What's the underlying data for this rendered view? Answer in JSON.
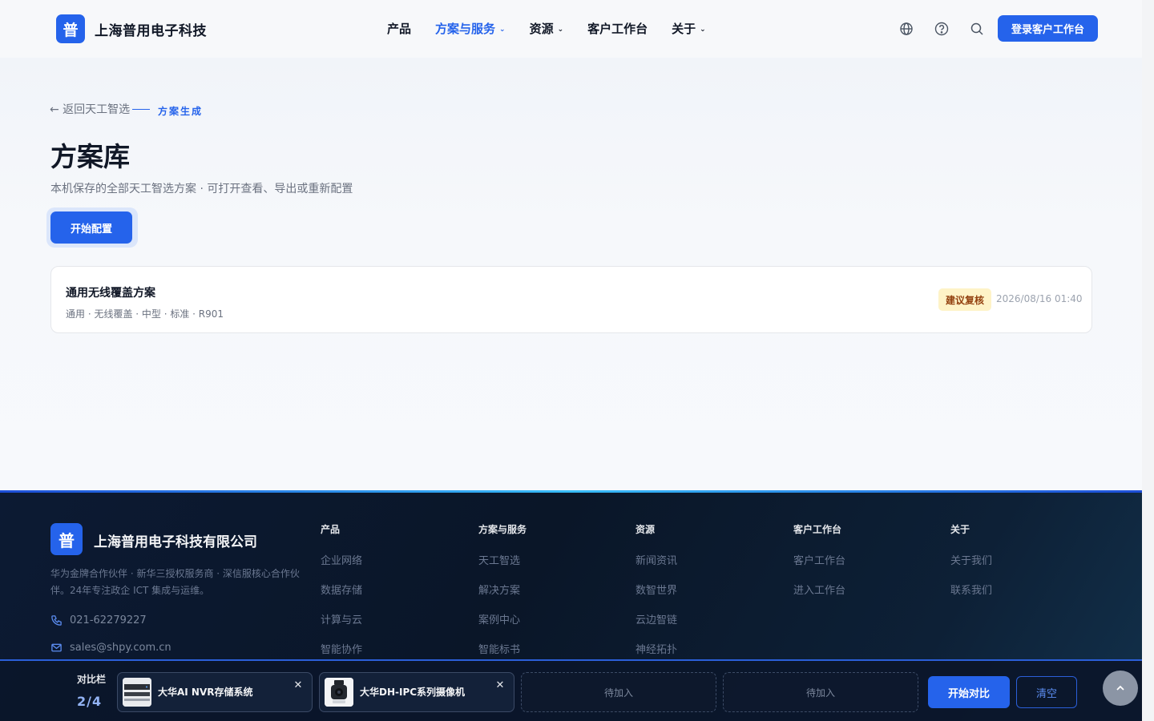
{
  "header": {
    "logo_char": "普",
    "brand": "上海普用电子科技",
    "nav": [
      {
        "label": "产品",
        "has_menu": false,
        "active": false
      },
      {
        "label": "方案与服务",
        "has_menu": true,
        "active": true
      },
      {
        "label": "资源",
        "has_menu": true,
        "active": false
      },
      {
        "label": "客户工作台",
        "has_menu": false,
        "active": false
      },
      {
        "label": "关于",
        "has_menu": true,
        "active": false
      }
    ],
    "icons": [
      "globe-icon",
      "help-icon",
      "search-icon"
    ],
    "login_label": "登录客户工作台",
    "accent": "#2563eb"
  },
  "breadcrumb": {
    "back_label": "← 返回天工智选",
    "current": "方案生成"
  },
  "page": {
    "title": "方案库",
    "description": "本机保存的全部天工智选方案 · 可打开查看、导出或重新配置",
    "start_label": "开始配置"
  },
  "plans": [
    {
      "name": "通用无线覆盖方案",
      "meta": "通用 · 无线覆盖 · 中型 · 标准 · R901",
      "badge": "建议复核",
      "date": "2026/08/16 01:40"
    }
  ],
  "footer": {
    "logo_char": "普",
    "company": "上海普用电子科技有限公司",
    "description": "华为金牌合作伙伴 · 新华三授权服务商 · 深信服核心合作伙伴。24年专注政企 ICT 集成与运维。",
    "phone": "021-62279227",
    "email": "sales@shpy.com.cn",
    "columns": [
      {
        "title": "产品",
        "items": [
          "企业网络",
          "数据存储",
          "计算与云",
          "智能协作"
        ]
      },
      {
        "title": "方案与服务",
        "items": [
          "天工智选",
          "解决方案",
          "案例中心",
          "智能标书"
        ]
      },
      {
        "title": "资源",
        "items": [
          "新闻资讯",
          "数智世界",
          "云边智链",
          "神经拓扑"
        ]
      },
      {
        "title": "客户工作台",
        "items": [
          "客户工作台",
          "进入工作台"
        ]
      },
      {
        "title": "关于",
        "items": [
          "关于我们",
          "联系我们"
        ]
      }
    ]
  },
  "compare": {
    "label": "对比栏",
    "count": "2/4",
    "slots": [
      {
        "name": "大华AI NVR存储系统",
        "filled": true,
        "thumb": "nvr"
      },
      {
        "name": "大华DH-IPC系列摄像机",
        "filled": true,
        "thumb": "camera"
      },
      {
        "name": "待加入",
        "filled": false
      },
      {
        "name": "待加入",
        "filled": false
      }
    ],
    "start_label": "开始对比",
    "clear_label": "清空"
  }
}
